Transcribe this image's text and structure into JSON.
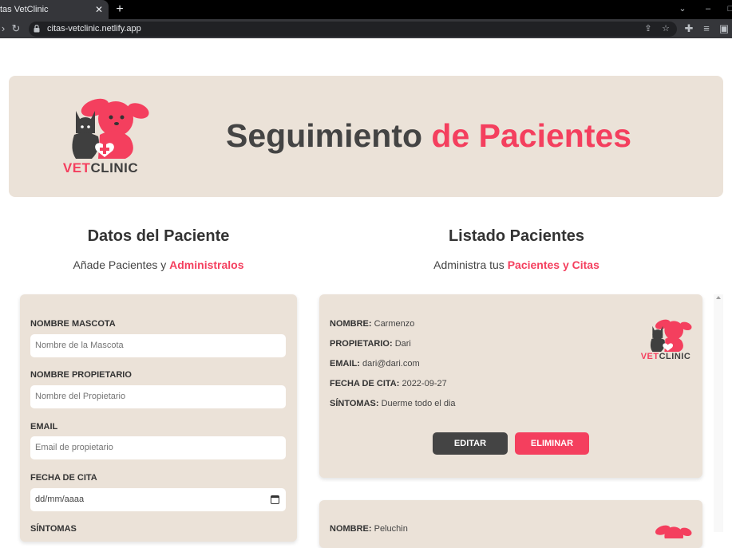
{
  "browser": {
    "tab_title": "tas VetClinic",
    "url": "citas-vetclinic.netlify.app"
  },
  "header": {
    "logo": {
      "vet": "VET",
      "clinic": "CLINIC"
    },
    "title_main": "Seguimiento ",
    "title_accent": "de Pacientes"
  },
  "form_section": {
    "title": "Datos del Paciente",
    "subtitle": "Añade Pacientes y ",
    "subtitle_accent": "Administralos",
    "fields": [
      {
        "label": "Nombre Mascota",
        "placeholder": "Nombre de la Mascota"
      },
      {
        "label": "Nombre Propietario",
        "placeholder": "Nombre del Propietario"
      },
      {
        "label": "Email",
        "placeholder": "Email de propietario"
      },
      {
        "label": "Fecha de Cita",
        "placeholder": "dd/mm/aaaa"
      },
      {
        "label": "Síntomas"
      }
    ]
  },
  "list_section": {
    "title": "Listado Pacientes",
    "subtitle": "Administra tus ",
    "subtitle_accent": "Pacientes y Citas",
    "patients": [
      {
        "name_label": "NOMBRE:",
        "name": "Carmenzo",
        "owner_label": "PROPIETARIO:",
        "owner": "Dari",
        "email_label": "EMAIL:",
        "email": "dari@dari.com",
        "date_label": "FECHA DE CITA:",
        "date": "2022-09-27",
        "symptoms_label": "SÍNTOMAS:",
        "symptoms": "Duerme todo el dia",
        "edit_label": "EDITAR",
        "delete_label": "ELIMINAR"
      },
      {
        "name_label": "NOMBRE:",
        "name": "Peluchin"
      }
    ]
  },
  "colors": {
    "accent": "#f43f5e",
    "card": "#ebe2d8",
    "dark": "#444444"
  }
}
